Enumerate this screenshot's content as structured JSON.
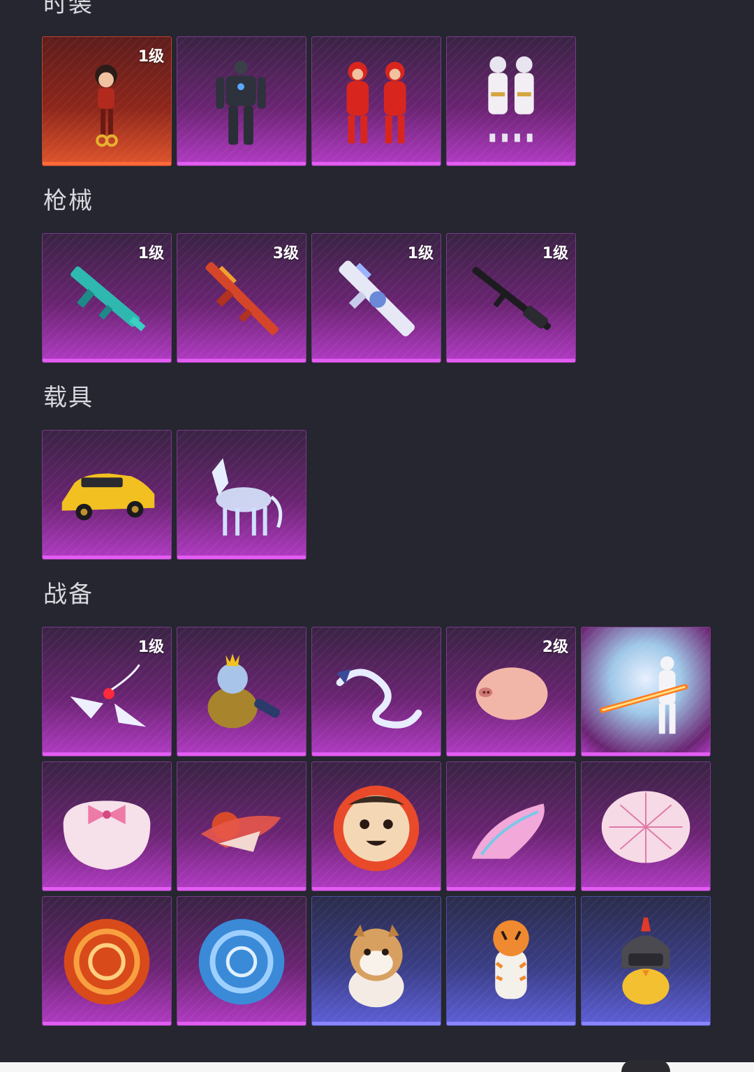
{
  "sections": [
    {
      "title": "时装",
      "items": [
        {
          "icon": "red-outfit-girl-icon",
          "rarity": "red",
          "level": "1级"
        },
        {
          "icon": "mech-armor-suit-icon",
          "rarity": "purple",
          "level": ""
        },
        {
          "icon": "red-twin-pig-suits-icon",
          "rarity": "purple",
          "level": ""
        },
        {
          "icon": "white-gold-outfit-set-icon",
          "rarity": "purple",
          "level": ""
        }
      ]
    },
    {
      "title": "枪械",
      "items": [
        {
          "icon": "teal-smg-skin-icon",
          "rarity": "purple",
          "level": "1级"
        },
        {
          "icon": "red-dragon-rifle-skin-icon",
          "rarity": "purple",
          "level": "3级"
        },
        {
          "icon": "white-crystal-rifle-skin-icon",
          "rarity": "purple",
          "level": "1级"
        },
        {
          "icon": "black-machine-gun-icon",
          "rarity": "purple",
          "level": "1级"
        }
      ]
    },
    {
      "title": "载具",
      "items": [
        {
          "icon": "yellow-suv-icon",
          "rarity": "purple",
          "level": ""
        },
        {
          "icon": "ice-crystal-horse-icon",
          "rarity": "purple",
          "level": ""
        }
      ]
    },
    {
      "title": "战备",
      "items": [
        {
          "icon": "winged-grenade-skin-icon",
          "rarity": "purple",
          "level": "1级"
        },
        {
          "icon": "elephant-backpack-icon",
          "rarity": "purple",
          "level": ""
        },
        {
          "icon": "white-dragon-glider-icon",
          "rarity": "purple",
          "level": ""
        },
        {
          "icon": "pig-helmet-icon",
          "rarity": "purple",
          "level": "2级"
        },
        {
          "icon": "flame-weapon-emote-icon",
          "rarity": "purple",
          "level": ""
        },
        {
          "icon": "pink-bow-parachute-icon",
          "rarity": "purple",
          "level": ""
        },
        {
          "icon": "red-phoenix-glider-icon",
          "rarity": "purple",
          "level": ""
        },
        {
          "icon": "boy-face-parachute-icon",
          "rarity": "purple",
          "level": ""
        },
        {
          "icon": "pink-wing-glider-icon",
          "rarity": "purple",
          "level": ""
        },
        {
          "icon": "pink-plaid-parachute-icon",
          "rarity": "purple",
          "level": ""
        },
        {
          "icon": "fire-swirl-parachute-icon",
          "rarity": "purple",
          "level": ""
        },
        {
          "icon": "ice-swirl-parachute-icon",
          "rarity": "purple",
          "level": ""
        },
        {
          "icon": "shiba-dog-pet-icon",
          "rarity": "blue",
          "level": ""
        },
        {
          "icon": "tiger-pet-icon",
          "rarity": "blue",
          "level": ""
        },
        {
          "icon": "helmet-chick-pet-icon",
          "rarity": "blue",
          "level": ""
        }
      ]
    }
  ],
  "colors": {
    "background": "#25262f",
    "purple_rarity": "#b23bc4",
    "red_rarity": "#e0542b",
    "blue_rarity": "#5e5fd8"
  }
}
